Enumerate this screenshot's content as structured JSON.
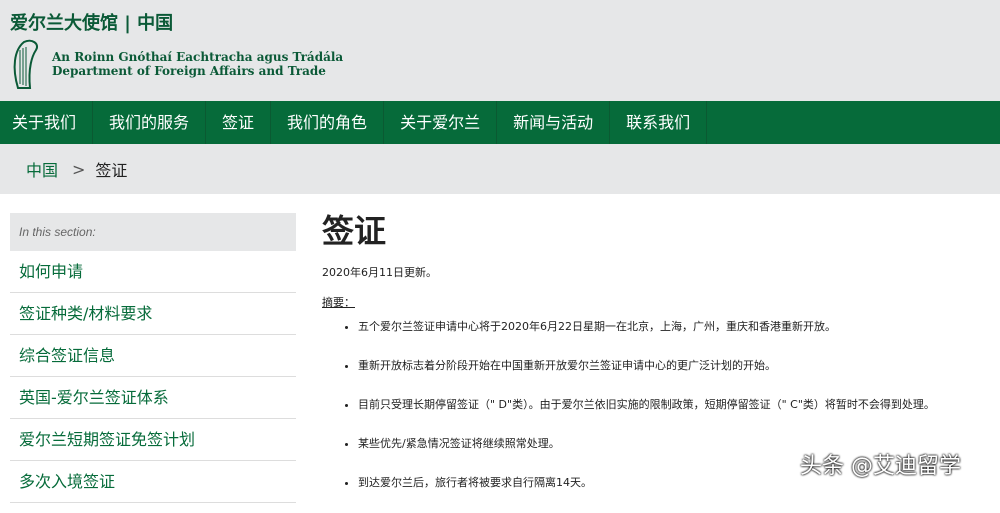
{
  "header": {
    "site_title": "爱尔兰大使馆 | 中国",
    "dept_irish": "An Roinn Gnóthaí Eachtracha agus Trádála",
    "dept_english": "Department of Foreign Affairs and Trade"
  },
  "nav": [
    "关于我们",
    "我们的服务",
    "签证",
    "我们的角色",
    "关于爱尔兰",
    "新闻与活动",
    "联系我们"
  ],
  "breadcrumb": {
    "home": "中国",
    "sep": ">",
    "current": "签证"
  },
  "sidebar": {
    "section_label": "In this section:",
    "items": [
      "如何申请",
      "签证种类/材料要求",
      "综合签证信息",
      "英国-爱尔兰签证体系",
      "爱尔兰短期签证免签计划",
      "多次入境签证"
    ]
  },
  "main": {
    "title": "签证",
    "date": "2020年6月11日更新。",
    "summary_label": "摘要：",
    "bullets": [
      "五个爱尔兰签证申请中心将于2020年6月22日星期一在北京，上海，广州，重庆和香港重新开放。",
      "重新开放标志着分阶段开始在中国重新开放爱尔兰签证申请中心的更广泛计划的开始。",
      "目前只受理长期停留签证（\" D\"类）。由于爱尔兰依旧实施的限制政策，短期停留签证（\" C\"类）将暂时不会得到处理。",
      "某些优先/紧急情况签证将继续照常处理。",
      "到达爱尔兰后，旅行者将被要求自行隔离14天。"
    ]
  },
  "watermark": "头条 @艾迪留学"
}
